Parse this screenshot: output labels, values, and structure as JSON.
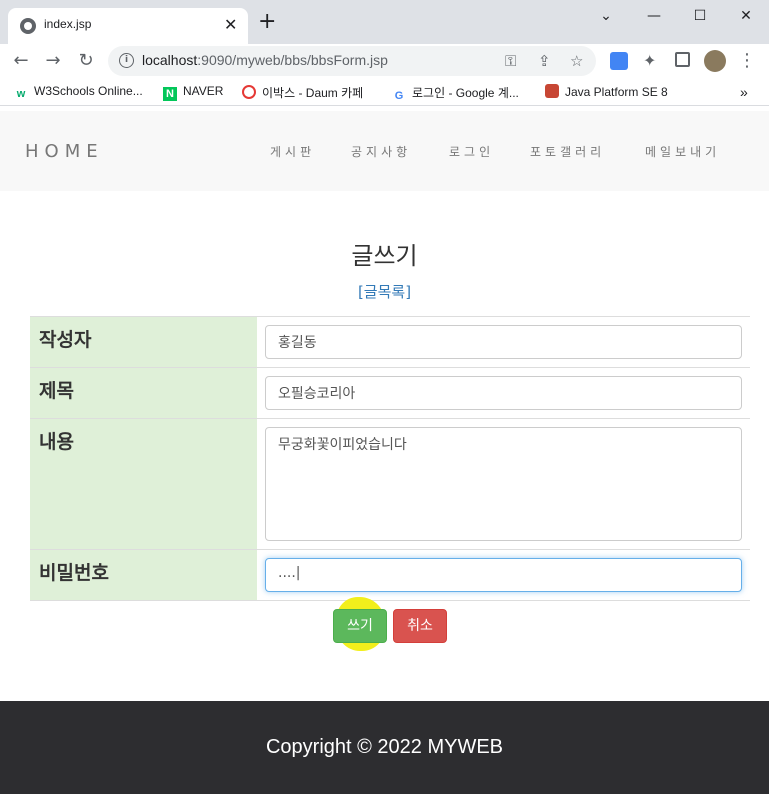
{
  "browser": {
    "tab_title": "index.jsp",
    "url_host": "localhost",
    "url_path": ":9090/myweb/bbs/bbsForm.jsp",
    "bookmarks": [
      {
        "label": "W3Schools Online...",
        "icon": "w3schools-icon",
        "color": "#04aa6d"
      },
      {
        "label": "NAVER",
        "icon": "naver-icon",
        "color": "#03c75a"
      },
      {
        "label": "이박스 - Daum 카페",
        "icon": "daum-cafe-icon",
        "color": "#e53935"
      },
      {
        "label": "로그인 - Google 계...",
        "icon": "google-icon",
        "color": "#4285f4"
      },
      {
        "label": "Java Platform SE 8",
        "icon": "oracle-icon",
        "color": "#c74634"
      }
    ]
  },
  "site": {
    "brand": "HOME",
    "nav": [
      "게시판",
      "공지사항",
      "로그인",
      "포토갤러리",
      "메일보내기"
    ]
  },
  "form": {
    "title": "글쓰기",
    "list_link": "[글목록]",
    "fields": {
      "author_label": "작성자",
      "author_value": "홍길동",
      "subject_label": "제목",
      "subject_value": "오필승코리아",
      "content_label": "내용",
      "content_value": "무궁화꽃이피었습니다",
      "password_label": "비밀번호",
      "password_value": "....|"
    },
    "write_button": "쓰기",
    "cancel_button": "취소"
  },
  "footer": {
    "text": "Copyright © 2022 MYWEB"
  },
  "colors": {
    "label_bg": "#dff0d8",
    "write_button": "#5cb85c",
    "cancel_button": "#d9534f",
    "footer_bg": "#2d2d30",
    "highlight": "#f2ef1c"
  }
}
